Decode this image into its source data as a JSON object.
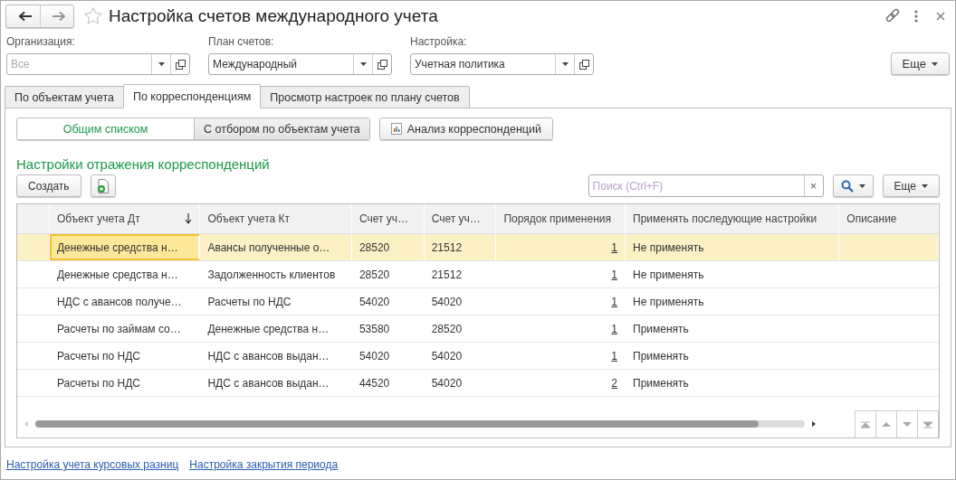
{
  "window": {
    "title": "Настройка счетов международного учета"
  },
  "filters": [
    {
      "label": "Организация:",
      "placeholder": "Все"
    },
    {
      "label": "План счетов:",
      "value": "Международный"
    },
    {
      "label": "Настройка:",
      "value": "Учетная политика"
    }
  ],
  "more_button": "Еще",
  "tabs": [
    {
      "label": "По объектам учета",
      "selected": false
    },
    {
      "label": "По корреспонденциям",
      "selected": true
    },
    {
      "label": "Просмотр настроек по плану счетов",
      "selected": false
    }
  ],
  "view_switch": [
    {
      "label": "Общим списком",
      "selected": true
    },
    {
      "label": "С отбором по объектам учета",
      "selected": false
    }
  ],
  "analysis_button": "Анализ корреспонденций",
  "section_title": "Настройки отражения корреспонденций",
  "toolbar": {
    "create_button": "Создать",
    "search": {
      "placeholder": "Поиск (Ctrl+F)"
    },
    "clear": "×",
    "more_button": "Еще"
  },
  "table": {
    "columns": [
      {
        "label": "Объект учета Дт",
        "sorted": true
      },
      {
        "label": "Объект учета Кт",
        "sorted": false
      },
      {
        "label": "Счет уч…",
        "sorted": false
      },
      {
        "label": "Счет уч…",
        "sorted": false
      },
      {
        "label": "Порядок применения",
        "sorted": false
      },
      {
        "label": "Применять последующие настройки",
        "sorted": false
      },
      {
        "label": "Описание",
        "sorted": false
      }
    ],
    "rows": [
      {
        "selected": true,
        "cells": [
          "Денежные средства н…",
          "Авансы полученные о…",
          "28520",
          "21512",
          "1",
          "Не применять",
          ""
        ]
      },
      {
        "selected": false,
        "cells": [
          "Денежные средства н…",
          "Задолженность клиентов",
          "28520",
          "21512",
          "1",
          "Не применять",
          ""
        ]
      },
      {
        "selected": false,
        "cells": [
          "НДС с авансов получе…",
          "Расчеты по НДС",
          "54020",
          "54020",
          "1",
          "Не применять",
          ""
        ]
      },
      {
        "selected": false,
        "cells": [
          "Расчеты по займам со…",
          "Денежные средства н…",
          "53580",
          "28520",
          "1",
          "Применять",
          ""
        ]
      },
      {
        "selected": false,
        "cells": [
          "Расчеты по НДС",
          "НДС с авансов выдан…",
          "54020",
          "54020",
          "1",
          "Применять",
          ""
        ]
      },
      {
        "selected": false,
        "cells": [
          "Расчеты по НДС",
          "НДС с авансов выдан…",
          "44520",
          "54020",
          "2",
          "Применять",
          ""
        ]
      }
    ]
  },
  "links": [
    "Настройка учета курсовых разниц",
    "Настройка закрытия периода"
  ]
}
